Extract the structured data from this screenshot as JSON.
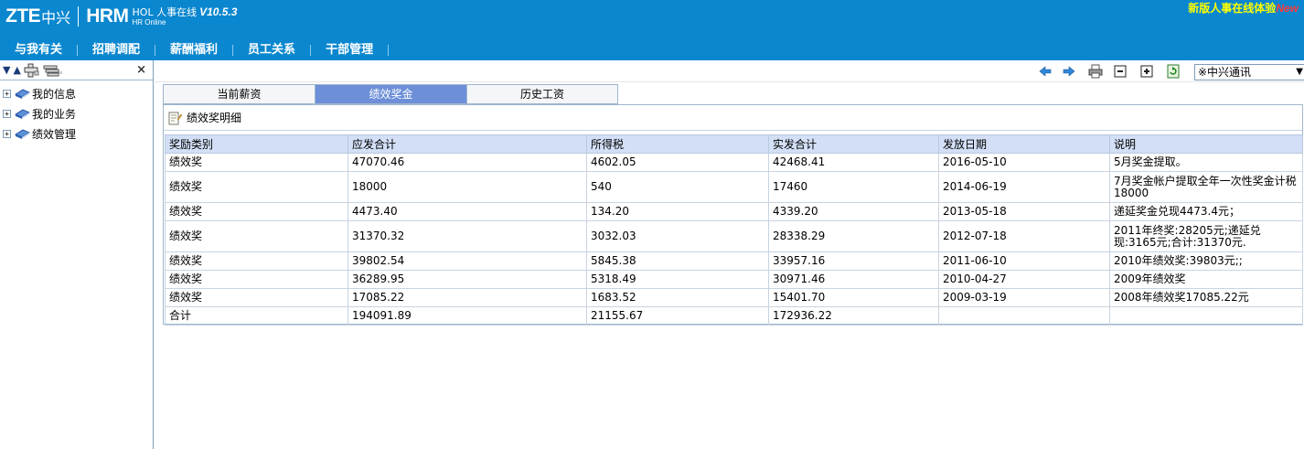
{
  "app": {
    "logo_zte": "ZTE",
    "logo_cn": "中兴",
    "logo_hrm": "HRM",
    "logo_hol": "HOL 人事在线",
    "logo_version": "V10.5.3",
    "logo_sub": "HR Online",
    "new_version_label": "新版人事在线体验",
    "new_version_tag": "New"
  },
  "nav": {
    "items": [
      "与我有关",
      "招聘调配",
      "薪酬福利",
      "员工关系",
      "干部管理"
    ]
  },
  "left_tree": {
    "nodes": [
      {
        "expander": "+",
        "label": "我的信息"
      },
      {
        "expander": "+",
        "label": "我的业务"
      },
      {
        "expander": "+",
        "label": "绩效管理"
      }
    ]
  },
  "toolbar": {
    "company_selected": "※中兴通讯"
  },
  "tabs": {
    "items": [
      "当前薪资",
      "绩效奖金",
      "历史工资"
    ],
    "active_index": 1
  },
  "panel": {
    "title": "绩效奖明细"
  },
  "table": {
    "columns": [
      "奖励类别",
      "应发合计",
      "所得税",
      "实发合计",
      "发放日期",
      "说明"
    ],
    "rows": [
      [
        "绩效奖",
        "47070.46",
        "4602.05",
        "42468.41",
        "2016-05-10",
        "5月奖金提取。"
      ],
      [
        "绩效奖",
        "18000",
        "540",
        "17460",
        "2014-06-19",
        "7月奖金帐户提取全年一次性奖金计税18000"
      ],
      [
        "绩效奖",
        "4473.40",
        "134.20",
        "4339.20",
        "2013-05-18",
        "递延奖金兑现4473.4元；"
      ],
      [
        "绩效奖",
        "31370.32",
        "3032.03",
        "28338.29",
        "2012-07-18",
        "2011年终奖:28205元;递延兑现:3165元;合计:31370元."
      ],
      [
        "绩效奖",
        "39802.54",
        "5845.38",
        "33957.16",
        "2011-06-10",
        "2010年绩效奖:39803元;;"
      ],
      [
        "绩效奖",
        "36289.95",
        "5318.49",
        "30971.46",
        "2010-04-27",
        "2009年绩效奖"
      ],
      [
        "绩效奖",
        "17085.22",
        "1683.52",
        "15401.70",
        "2009-03-19",
        "2008年绩效奖17085.22元"
      ],
      [
        "合计",
        "194091.89",
        "21155.67",
        "172936.22",
        "",
        ""
      ]
    ]
  },
  "colors": {
    "header_bg": "#0a87cf",
    "tab_active_bg": "#6d8fd8",
    "table_header_bg": "#d2dff6",
    "new_version_color": "#ffff00",
    "new_tag_color": "#ff3b3b"
  }
}
